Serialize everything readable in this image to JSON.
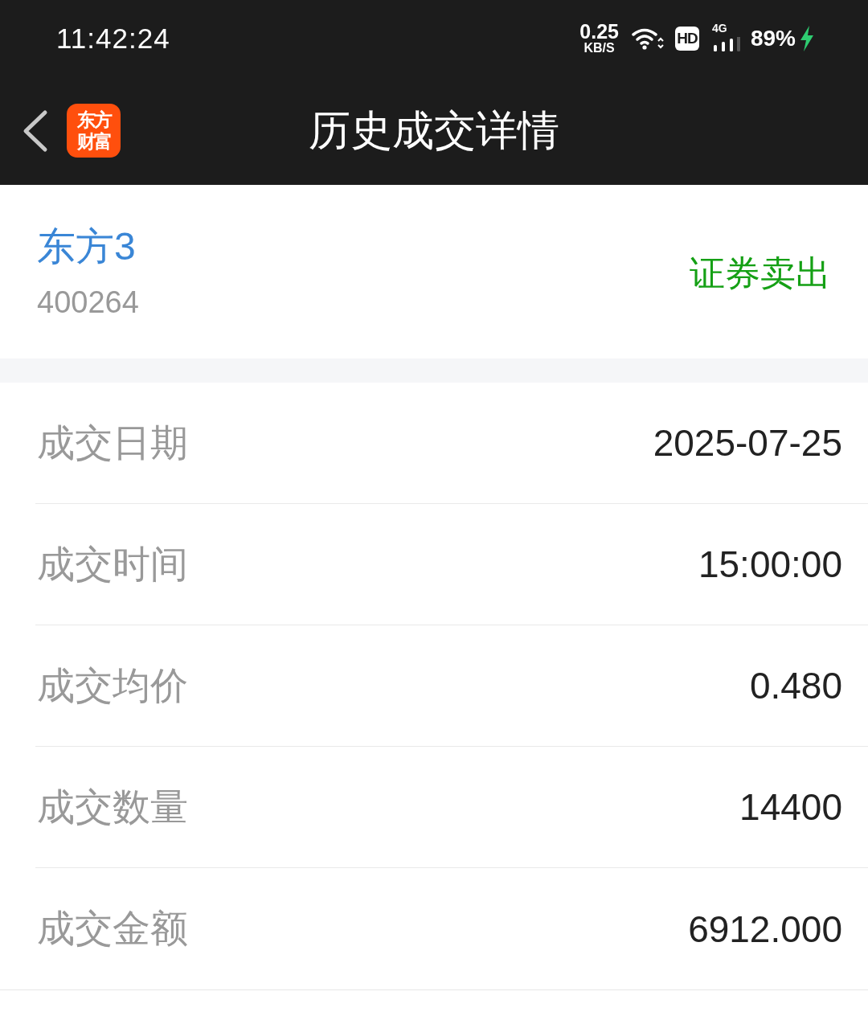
{
  "status_bar": {
    "time": "11:42:24",
    "net_speed": "0.25",
    "net_unit": "KB/S",
    "hd_badge": "HD",
    "network": "4G",
    "battery": "89%",
    "charging": true
  },
  "header": {
    "title": "历史成交详情",
    "logo_lines": [
      "东方",
      "财富"
    ]
  },
  "stock": {
    "name": "东方3",
    "code": "400264",
    "direction": "证券卖出"
  },
  "details": [
    {
      "label": "成交日期",
      "value": "2025-07-25"
    },
    {
      "label": "成交时间",
      "value": "15:00:00"
    },
    {
      "label": "成交均价",
      "value": "0.480"
    },
    {
      "label": "成交数量",
      "value": "14400"
    },
    {
      "label": "成交金额",
      "value": "6912.000"
    }
  ]
}
